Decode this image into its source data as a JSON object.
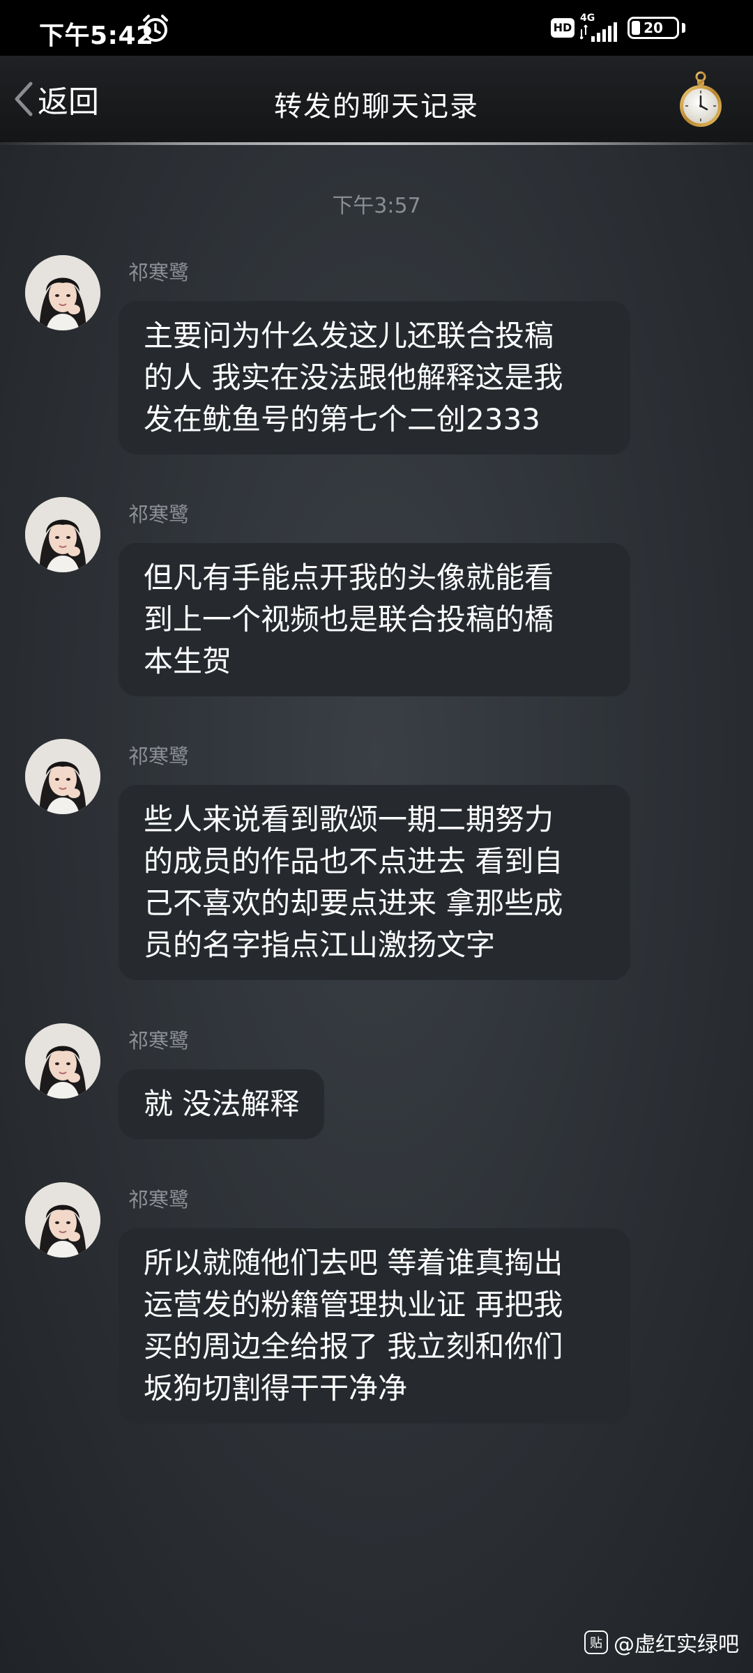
{
  "status_bar": {
    "time": "下午5:42",
    "hd": "HD",
    "network": "4G",
    "battery": "20",
    "battery_level": 0.2
  },
  "header": {
    "back_label": "返回",
    "title": "转发的聊天记录"
  },
  "chat": {
    "timestamp": "下午3:57",
    "messages": [
      {
        "sender": "祁寒鹭",
        "lines": [
          "主要问为什么发这儿还联合投稿",
          "的人 我实在没法跟他解释这是我",
          "发在鱿鱼号的第七个二创2333"
        ]
      },
      {
        "sender": "祁寒鹭",
        "lines": [
          "但凡有手能点开我的头像就能看",
          "到上一个视频也是联合投稿的橋",
          "本生贺"
        ]
      },
      {
        "sender": "祁寒鹭",
        "lines": [
          "些人来说看到歌颂一期二期努力",
          "的成员的作品也不点进去 看到自",
          "己不喜欢的却要点进来 拿那些成",
          "员的名字指点江山激扬文字"
        ]
      },
      {
        "sender": "祁寒鹭",
        "lines": [
          "就 没法解释"
        ]
      },
      {
        "sender": "祁寒鹭",
        "lines": [
          "所以就随他们去吧 等着谁真掏出",
          "运营发的粉籍管理执业证 再把我",
          "买的周边全给报了 我立刻和你们",
          "坂狗切割得干干净净"
        ]
      }
    ]
  },
  "watermark": {
    "icon_label": "贴",
    "text": "@虚红实绿吧"
  }
}
